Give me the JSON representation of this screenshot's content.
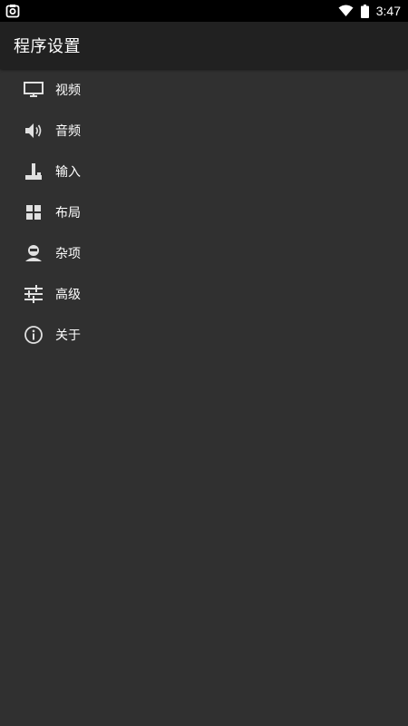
{
  "status_bar": {
    "time": "3:47",
    "left_icon": "screenshot-icon",
    "right_icons": [
      "wifi-icon",
      "battery-icon"
    ]
  },
  "app_bar": {
    "title": "程序设置"
  },
  "menu": {
    "items": [
      {
        "icon": "monitor-icon",
        "label": "视频"
      },
      {
        "icon": "speaker-icon",
        "label": "音频"
      },
      {
        "icon": "joystick-icon",
        "label": "输入"
      },
      {
        "icon": "grid-icon",
        "label": "布局"
      },
      {
        "icon": "person-icon",
        "label": "杂项"
      },
      {
        "icon": "sliders-icon",
        "label": "高级"
      },
      {
        "icon": "info-icon",
        "label": "关于"
      }
    ]
  },
  "colors": {
    "background": "#303030",
    "app_bar": "#212121",
    "status_bar": "#000000",
    "text": "#ffffff",
    "icon": "#e0e0e0"
  }
}
